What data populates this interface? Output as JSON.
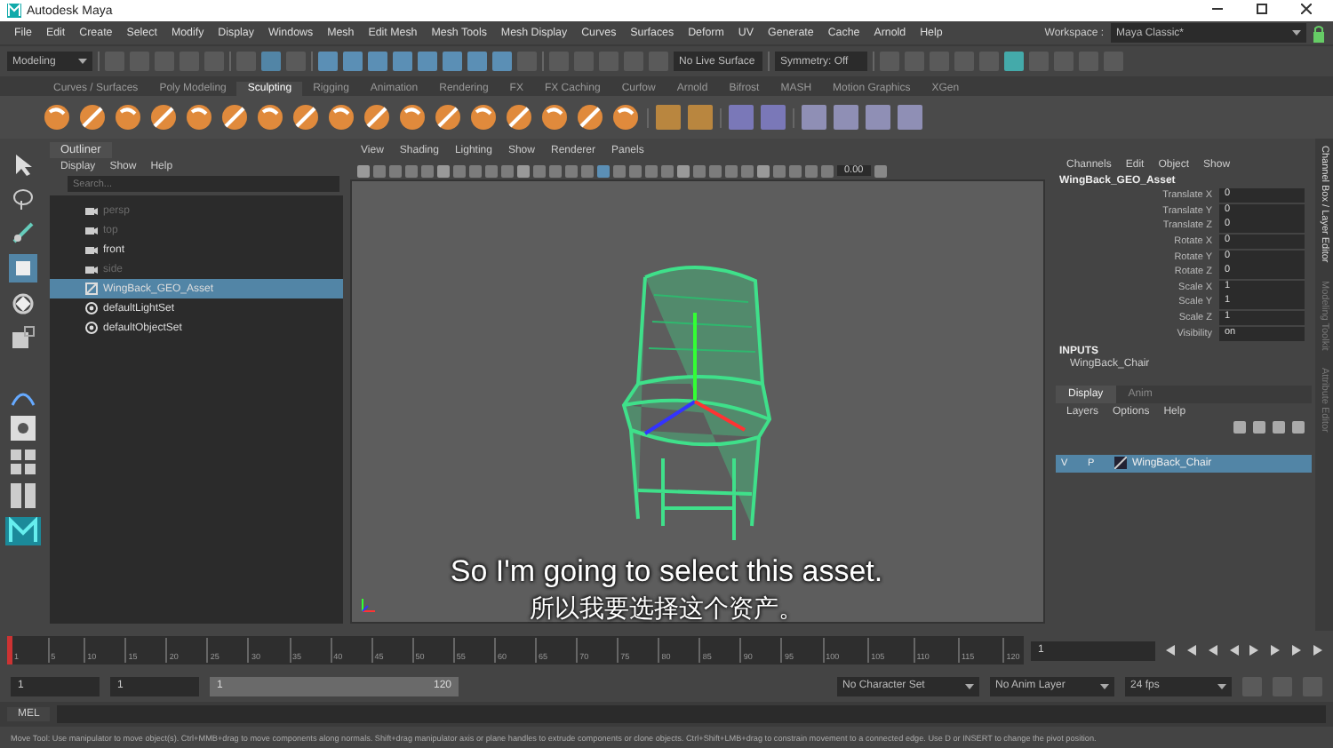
{
  "window": {
    "title": "Autodesk Maya"
  },
  "menu": [
    "File",
    "Edit",
    "Create",
    "Select",
    "Modify",
    "Display",
    "Windows",
    "Mesh",
    "Edit Mesh",
    "Mesh Tools",
    "Mesh Display",
    "Curves",
    "Surfaces",
    "Deform",
    "UV",
    "Generate",
    "Cache",
    "Arnold",
    "Help"
  ],
  "status_line": {
    "mode": "Modeling",
    "live_surface": "No Live Surface",
    "symmetry": "Symmetry: Off",
    "workspace_label": "Workspace :",
    "workspace": "Maya Classic*"
  },
  "shelf_tabs": [
    {
      "label": "Curves / Surfaces",
      "selected": false
    },
    {
      "label": "Poly Modeling",
      "selected": false
    },
    {
      "label": "Sculpting",
      "selected": true
    },
    {
      "label": "Rigging",
      "selected": false
    },
    {
      "label": "Animation",
      "selected": false
    },
    {
      "label": "Rendering",
      "selected": false
    },
    {
      "label": "FX",
      "selected": false
    },
    {
      "label": "FX Caching",
      "selected": false
    },
    {
      "label": "Curfow",
      "selected": false
    },
    {
      "label": "Arnold",
      "selected": false
    },
    {
      "label": "Bifrost",
      "selected": false
    },
    {
      "label": "MASH",
      "selected": false
    },
    {
      "label": "Motion Graphics",
      "selected": false
    },
    {
      "label": "XGen",
      "selected": false
    }
  ],
  "outliner": {
    "title": "Outliner",
    "menu": [
      "Display",
      "Show",
      "Help"
    ],
    "search_placeholder": "Search...",
    "items": [
      {
        "label": "persp",
        "kind": "camera",
        "dimmed": true,
        "selected": false
      },
      {
        "label": "top",
        "kind": "camera",
        "dimmed": true,
        "selected": false
      },
      {
        "label": "front",
        "kind": "camera",
        "dimmed": false,
        "selected": false
      },
      {
        "label": "side",
        "kind": "camera",
        "dimmed": true,
        "selected": false
      },
      {
        "label": "WingBack_GEO_Asset",
        "kind": "mesh",
        "dimmed": false,
        "selected": true
      },
      {
        "label": "defaultLightSet",
        "kind": "set",
        "dimmed": false,
        "selected": false
      },
      {
        "label": "defaultObjectSet",
        "kind": "set",
        "dimmed": false,
        "selected": false
      }
    ]
  },
  "viewport": {
    "menu": [
      "View",
      "Shading",
      "Lighting",
      "Show",
      "Renderer",
      "Panels"
    ],
    "exposure": "0.00"
  },
  "channel_box": {
    "menu": [
      "Channels",
      "Edit",
      "Object",
      "Show"
    ],
    "object": "WingBack_GEO_Asset",
    "channels": [
      {
        "name": "Translate X",
        "value": "0"
      },
      {
        "name": "Translate Y",
        "value": "0"
      },
      {
        "name": "Translate Z",
        "value": "0"
      },
      {
        "name": "Rotate X",
        "value": "0"
      },
      {
        "name": "Rotate Y",
        "value": "0"
      },
      {
        "name": "Rotate Z",
        "value": "0"
      },
      {
        "name": "Scale X",
        "value": "1"
      },
      {
        "name": "Scale Y",
        "value": "1"
      },
      {
        "name": "Scale Z",
        "value": "1"
      },
      {
        "name": "Visibility",
        "value": "on"
      }
    ],
    "inputs_label": "INPUTS",
    "input": "WingBack_Chair"
  },
  "layer_editor": {
    "tabs": [
      {
        "label": "Display",
        "selected": true
      },
      {
        "label": "Anim",
        "selected": false
      }
    ],
    "menu": [
      "Layers",
      "Options",
      "Help"
    ],
    "layers": [
      {
        "visible": "V",
        "playback": "P",
        "name": "WingBack_Chair",
        "selected": true
      }
    ]
  },
  "side_tabs": [
    "Channel Box / Layer Editor",
    "Modeling Toolkit",
    "Attribute Editor"
  ],
  "time_slider": {
    "level": 0,
    "ticks": [
      "1",
      "5",
      "10",
      "15",
      "20",
      "25",
      "30",
      "35",
      "40",
      "45",
      "50",
      "55",
      "60",
      "65",
      "70",
      "75",
      "80",
      "85",
      "90",
      "95",
      "100",
      "105",
      "110",
      "115",
      "120"
    ],
    "current_frame": "1"
  },
  "range": {
    "level": 1,
    "start": "1",
    "playback_start": "1",
    "slider_start": "1",
    "slider_end": "120",
    "character_set": "No Character Set",
    "anim_layer": "No Anim Layer",
    "fps": "24 fps"
  },
  "command_line": {
    "language": "MEL"
  },
  "help_line": "Move Tool: Use manipulator to move object(s). Ctrl+MMB+drag to move components along normals. Shift+drag manipulator axis or plane handles to extrude components or clone objects. Ctrl+Shift+LMB+drag to constrain movement to a connected edge. Use D or INSERT to change the pivot position.",
  "subtitles": [
    "So I'm going to select this asset.",
    "所以我要选择这个资产。"
  ]
}
